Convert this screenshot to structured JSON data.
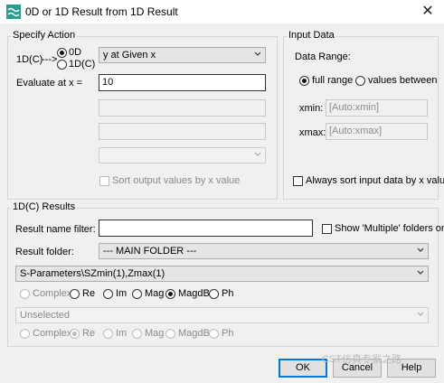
{
  "window": {
    "title": "0D or 1D Result from 1D Result",
    "close_glyph": "✕"
  },
  "specify_action": {
    "legend": "Specify Action",
    "source_label": "1D(C)",
    "arrow": "--->",
    "opt_0d": "0D",
    "opt_1dc": "1D(C)",
    "action_select": "y at Given x",
    "evaluate_label": "Evaluate at x =",
    "evaluate_value": "10",
    "sort_label": "Sort output values by x value"
  },
  "input_data": {
    "legend": "Input Data",
    "range_label": "Data Range:",
    "full_range": "full range",
    "values_between": "values between",
    "xmin_label": "xmin:",
    "xmin_value": "[Auto:xmin]",
    "xmax_label": "xmax:",
    "xmax_value": "[Auto:xmax]",
    "always_sort": "Always sort input data by x values"
  },
  "results": {
    "legend": "1D(C) Results",
    "filter_label": "Result name filter:",
    "filter_value": "",
    "show_multiple": "Show 'Multiple' folders only",
    "folder_label": "Result folder:",
    "folder_value": "--- MAIN FOLDER ---",
    "result_select": "S-Parameters\\SZmin(1),Zmax(1)",
    "components": [
      "Complex",
      "Re",
      "Im",
      "Mag",
      "MagdB",
      "Ph"
    ],
    "second_select": "Unselected",
    "components2": [
      "Complex",
      "Re",
      "Im",
      "Mag",
      "MagdB",
      "Ph"
    ]
  },
  "buttons": {
    "ok": "OK",
    "cancel": "Cancel",
    "help": "Help"
  },
  "watermark": "CST仿真专家之路",
  "colors": {
    "accent": "#0078d7",
    "icon": "#2a9d8f"
  }
}
